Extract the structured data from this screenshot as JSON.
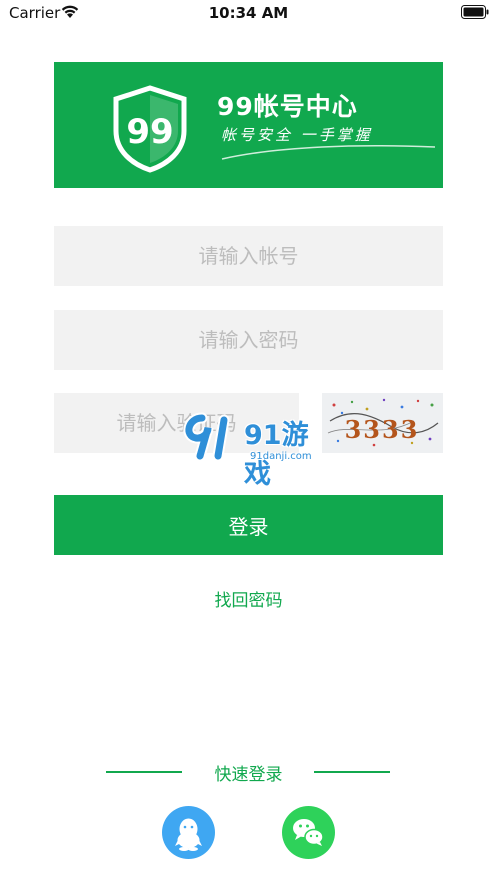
{
  "status_bar": {
    "carrier": "Carrier",
    "time": "10:34 AM",
    "icons": [
      "wifi-icon",
      "battery-icon"
    ]
  },
  "banner": {
    "logo_number": "99",
    "title": "99帐号中心",
    "slogan": "帐号安全 一手掌握"
  },
  "form": {
    "account_placeholder": "请输入帐号",
    "password_placeholder": "请输入密码",
    "captcha_placeholder": "请输入验证码",
    "captcha_code": "3333",
    "login_label": "登录",
    "forgot_label": "找回密码"
  },
  "quick_login": {
    "label": "快速登录",
    "options": [
      "qq-icon",
      "wechat-icon"
    ]
  },
  "watermark": {
    "brand": "91游戏",
    "domain": "91danji.com"
  },
  "colors": {
    "brand_green": "#11a84e",
    "field_bg": "#f2f2f2",
    "qq_blue": "#3fa7f2",
    "wechat_green": "#2ed25a"
  }
}
